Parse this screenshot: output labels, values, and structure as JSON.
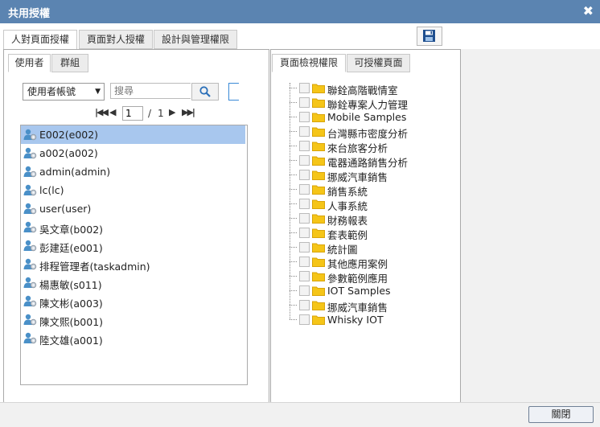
{
  "window": {
    "title": "共用授權",
    "close_glyph": "✖"
  },
  "top_tabs": [
    {
      "label": "人對頁面授權",
      "active": true
    },
    {
      "label": "頁面對人授權",
      "active": false
    },
    {
      "label": "設計與管理權限",
      "active": false
    }
  ],
  "left_tabs": [
    {
      "label": "使用者",
      "active": true
    },
    {
      "label": "群組",
      "active": false
    }
  ],
  "filter": {
    "field_selected": "使用者帳號",
    "search_placeholder": "搜尋"
  },
  "pager": {
    "current_page": "1",
    "separator": "/",
    "total_pages": "1"
  },
  "users": [
    {
      "label": "E002(e002)",
      "selected": true
    },
    {
      "label": "a002(a002)",
      "selected": false
    },
    {
      "label": "admin(admin)",
      "selected": false
    },
    {
      "label": "lc(lc)",
      "selected": false
    },
    {
      "label": "user(user)",
      "selected": false
    },
    {
      "label": "吳文章(b002)",
      "selected": false
    },
    {
      "label": "彭建廷(e001)",
      "selected": false
    },
    {
      "label": "排程管理者(taskadmin)",
      "selected": false
    },
    {
      "label": "楊惠敏(s011)",
      "selected": false
    },
    {
      "label": "陳文彬(a003)",
      "selected": false
    },
    {
      "label": "陳文熙(b001)",
      "selected": false
    },
    {
      "label": "陸文雄(a001)",
      "selected": false
    }
  ],
  "right_tabs": [
    {
      "label": "頁面檢視權限",
      "active": true
    },
    {
      "label": "可授權頁面",
      "active": false
    }
  ],
  "tree": [
    "聯銓高階戰情室",
    "聯銓專案人力管理",
    "Mobile Samples",
    "台灣縣市密度分析",
    "來台旅客分析",
    "電器通路銷售分析",
    "挪威汽車銷售",
    "銷售系統",
    "人事系統",
    "財務報表",
    "套表範例",
    "統計圖",
    "其他應用案例",
    "參數範例應用",
    "IOT Samples",
    "挪威汽車銷售",
    "Whisky IOT"
  ],
  "footer": {
    "close_label": "關閉"
  },
  "colors": {
    "titlebar": "#5b84b1",
    "selected_row": "#a8c7ee",
    "folder": "#f5c518",
    "user_icon": "#4a90c8"
  },
  "icons": [
    "close-icon",
    "save-icon",
    "search-icon",
    "user-gear-icon",
    "folder-icon"
  ]
}
